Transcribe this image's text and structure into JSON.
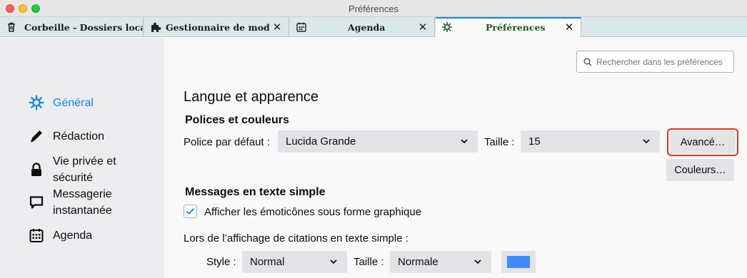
{
  "window": {
    "title": "Préférences"
  },
  "tabs": [
    {
      "label": "Corbeille - Dossiers locaux",
      "icon": "trash-icon"
    },
    {
      "label": "Gestionnaire de modules",
      "icon": "puzzle-icon",
      "close": "✕"
    },
    {
      "label": "Agenda",
      "icon": "calendar-icon",
      "close": "✕"
    },
    {
      "label": "Préférences",
      "icon": "gear-icon",
      "close": "✕",
      "active": true
    }
  ],
  "sidebar": {
    "items": [
      {
        "label": "Général",
        "icon": "gear-icon",
        "selected": true
      },
      {
        "label": "Rédaction",
        "icon": "pencil-icon"
      },
      {
        "label": "Vie privée et\nsécurité",
        "icon": "lock-icon"
      },
      {
        "label": "Messagerie\ninstantanée",
        "icon": "chat-icon"
      },
      {
        "label": "Agenda",
        "icon": "calendar-icon"
      }
    ]
  },
  "search": {
    "placeholder": "Rechercher dans les préférences"
  },
  "main": {
    "title": "Langue et apparence",
    "fonts": {
      "heading": "Polices et couleurs",
      "default_font_label": "Police par défaut :",
      "default_font_value": "Lucida Grande",
      "size_label": "Taille :",
      "size_value": "15",
      "advanced_button": "Avancé…",
      "colors_button": "Couleurs…"
    },
    "plain_text": {
      "heading": "Messages en texte simple",
      "emoticons_label": "Afficher les émoticônes sous forme graphique",
      "emoticons_checked": true,
      "quotes_label": "Lors de l’affichage de citations en texte simple :",
      "style_label": "Style :",
      "style_value": "Normal",
      "size_label": "Taille :",
      "size_value": "Normale",
      "quote_color": "#3d8bff"
    }
  },
  "colors": {
    "accent": "#0a84ff",
    "highlight_outline": "#e5331f"
  }
}
